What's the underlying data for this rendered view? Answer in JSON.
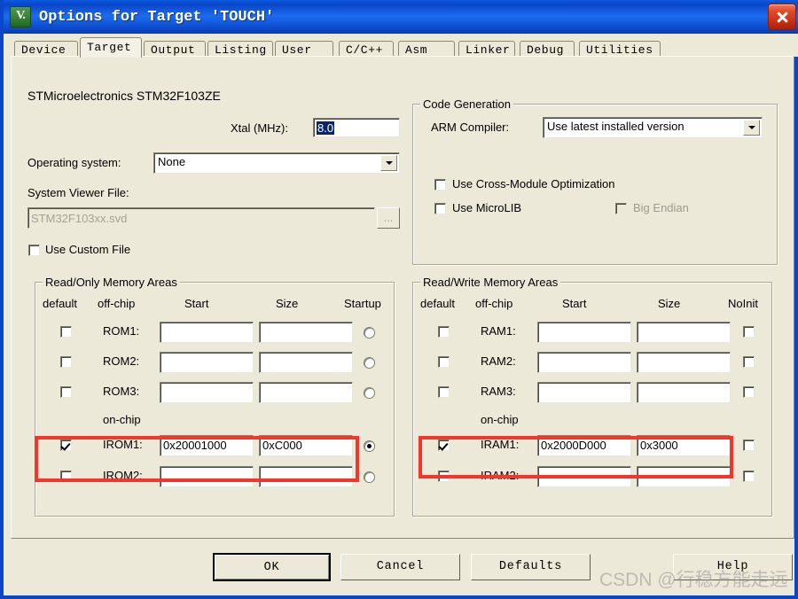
{
  "window": {
    "title": "Options for Target 'TOUCH'",
    "app_icon": "uvision-icon",
    "close_label": "close-icon"
  },
  "tabs": [
    {
      "label": "Device",
      "active": false
    },
    {
      "label": "Target",
      "active": true
    },
    {
      "label": "Output",
      "active": false
    },
    {
      "label": "Listing",
      "active": false
    },
    {
      "label": "User",
      "active": false
    },
    {
      "label": "C/C++",
      "active": false
    },
    {
      "label": "Asm",
      "active": false
    },
    {
      "label": "Linker",
      "active": false
    },
    {
      "label": "Debug",
      "active": false
    },
    {
      "label": "Utilities",
      "active": false
    }
  ],
  "target": {
    "device_name": "STMicroelectronics STM32F103ZE",
    "xtal_label": "Xtal (MHz):",
    "xtal_value": "8.0",
    "xtal_selected": true,
    "os_label": "Operating system:",
    "os_value": "None",
    "svd_label": "System Viewer File:",
    "svd_value": "STM32F103xx.svd",
    "svd_readonly": true,
    "browse_label": "...",
    "use_custom_file_label": "Use Custom File",
    "use_custom_file_checked": false
  },
  "code_generation": {
    "group_title": "Code Generation",
    "arm_compiler_label": "ARM Compiler:",
    "arm_compiler_value": "Use latest installed version",
    "cross_module_label": "Use Cross-Module Optimization",
    "cross_module_checked": false,
    "microlib_label": "Use MicroLIB",
    "microlib_checked": false,
    "big_endian_label": "Big Endian",
    "big_endian_checked": false,
    "big_endian_disabled": true
  },
  "read_only_memory": {
    "group_title": "Read/Only Memory Areas",
    "headers": [
      "default",
      "off-chip",
      "Start",
      "Size",
      "Startup"
    ],
    "onchip_label": "on-chip",
    "rows": [
      {
        "name": "ROM1:",
        "checked": false,
        "start": "",
        "size": "",
        "startup": false,
        "section": "off-chip"
      },
      {
        "name": "ROM2:",
        "checked": false,
        "start": "",
        "size": "",
        "startup": false,
        "section": "off-chip"
      },
      {
        "name": "ROM3:",
        "checked": false,
        "start": "",
        "size": "",
        "startup": false,
        "section": "off-chip"
      },
      {
        "name": "IROM1:",
        "checked": true,
        "start": "0x20001000",
        "size": "0xC000",
        "startup": true,
        "section": "on-chip"
      },
      {
        "name": "IROM2:",
        "checked": false,
        "start": "",
        "size": "",
        "startup": false,
        "section": "on-chip"
      }
    ]
  },
  "read_write_memory": {
    "group_title": "Read/Write Memory Areas",
    "headers": [
      "default",
      "off-chip",
      "Start",
      "Size",
      "NoInit"
    ],
    "onchip_label": "on-chip",
    "rows": [
      {
        "name": "RAM1:",
        "checked": false,
        "start": "",
        "size": "",
        "noinit": false,
        "section": "off-chip"
      },
      {
        "name": "RAM2:",
        "checked": false,
        "start": "",
        "size": "",
        "noinit": false,
        "section": "off-chip"
      },
      {
        "name": "RAM3:",
        "checked": false,
        "start": "",
        "size": "",
        "noinit": false,
        "section": "off-chip"
      },
      {
        "name": "IRAM1:",
        "checked": true,
        "start": "0x2000D000",
        "size": "0x3000",
        "noinit": false,
        "section": "on-chip"
      },
      {
        "name": "IRAM2:",
        "checked": false,
        "start": "",
        "size": "",
        "noinit": false,
        "section": "on-chip"
      }
    ]
  },
  "buttons": {
    "ok": "OK",
    "cancel": "Cancel",
    "defaults": "Defaults",
    "help": "Help"
  },
  "annotations": {
    "highlight_color": "#f5352a",
    "irom1_highlight": "IROM1 row highlighted",
    "iram1_highlight": "IRAM1 row highlighted"
  },
  "watermark": {
    "text": "CSDN @行稳方能走远"
  }
}
